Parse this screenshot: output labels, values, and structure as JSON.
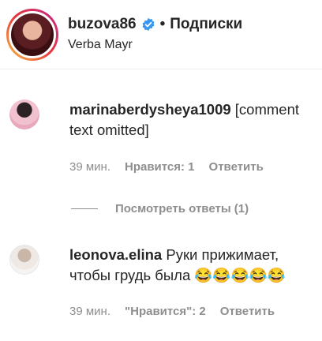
{
  "header": {
    "username": "buzova86",
    "separator": "•",
    "follow_label": "Подписки",
    "location": "Verba Mayr"
  },
  "comments": [
    {
      "username": "marinaberdysheya1009",
      "text": "[comment text omitted]",
      "time": "39 мин.",
      "likes": "Нравится: 1",
      "reply": "Ответить"
    },
    {
      "username": "leonova.elina",
      "text": "Руки прижимает, чтобы грудь была 😂😂😂😂😂",
      "time": "39 мин.",
      "likes": "\"Нравится\": 2",
      "reply": "Ответить"
    }
  ],
  "view_replies": "Посмотреть ответы (1)",
  "colors": {
    "verified": "#3897f0",
    "meta": "#8e8e8e",
    "text": "#262626"
  }
}
